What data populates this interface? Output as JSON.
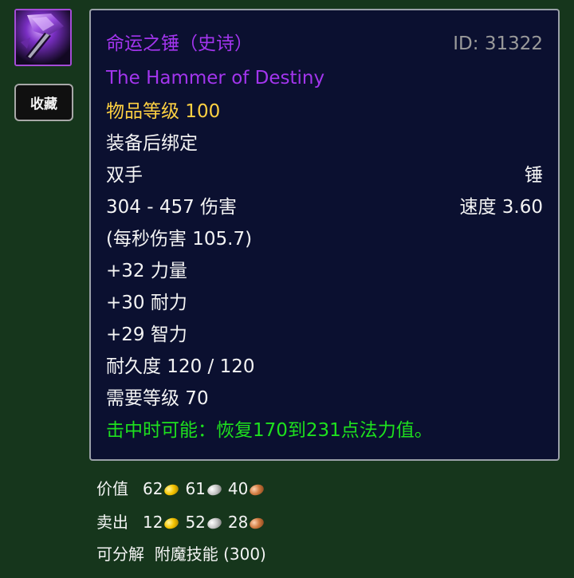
{
  "item": {
    "name_cn": "命运之锤（史诗）",
    "id_text": "ID: 31322",
    "name_en": "The Hammer of Destiny",
    "item_level": "物品等级 100",
    "binding": "装备后绑定",
    "slot": "双手",
    "type": "锤",
    "damage": "304 - 457 伤害",
    "speed": "速度 3.60",
    "dps": "(每秒伤害 105.7)",
    "stats": [
      "+32 力量",
      "+30 耐力",
      "+29 智力"
    ],
    "durability": "耐久度 120 / 120",
    "required_level": "需要等级 70",
    "on_hit": "击中时可能：恢复170到231点法力值。",
    "icon": "purple-hammer-icon"
  },
  "buttons": {
    "favorite_label": "收藏"
  },
  "value": {
    "label": "价值",
    "gold": "62",
    "silver": "61",
    "copper": "40"
  },
  "sell": {
    "label": "卖出",
    "gold": "12",
    "silver": "52",
    "copper": "28"
  },
  "disenchant": {
    "text": "可分解  附魔技能 (300)"
  },
  "colors": {
    "epic": "#a335ee",
    "item_level": "#ffd142",
    "green": "#1ee11e",
    "tooltip_bg": "#0b1030",
    "page_bg": "#16361c"
  }
}
